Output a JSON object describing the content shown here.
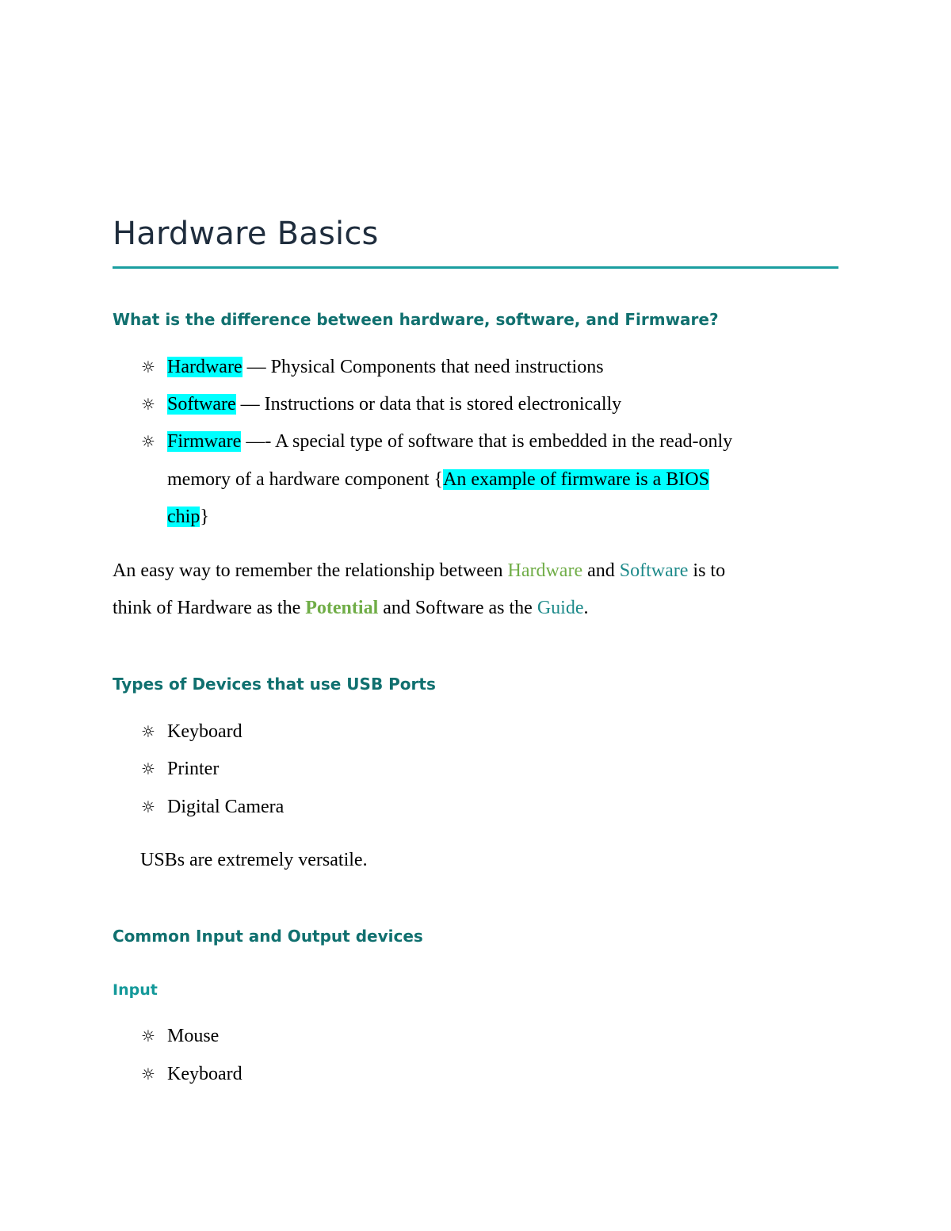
{
  "document": {
    "title": "Hardware Basics",
    "section1": {
      "heading": "What is the difference between hardware, software, and Firmware?",
      "items": [
        {
          "term": "Hardware",
          "rest": " — Physical Components that need instructions"
        },
        {
          "term": "Software",
          "rest": " — Instructions or data that is stored electronically"
        },
        {
          "term": "Firmware",
          "rest_line1": " —- A special type of software that is embedded in the read-only",
          "rest_line2_pre": "memory of a hardware component {",
          "highlight_line2": "An example of firmware is a BIOS ",
          "highlight_line3": "chip",
          "rest_line3": "}"
        }
      ],
      "paragraph": {
        "p1": "An easy way to remember the relationship between ",
        "hardware": "Hardware",
        "p2": " and ",
        "software": "Software",
        "p3": " is to",
        "p4": "think of Hardware as the ",
        "potential": "Potential",
        "p5": " and Software as the ",
        "guide": "Guide",
        "p6": "."
      }
    },
    "section2": {
      "heading": "Types of Devices that use USB Ports",
      "items": [
        "Keyboard",
        "Printer",
        "Digital Camera"
      ],
      "note": "USBs are extremely versatile."
    },
    "section3": {
      "heading": "Common Input and Output devices",
      "subheading": "Input",
      "items": [
        "Mouse",
        "Keyboard"
      ]
    },
    "bullet_icon": "☼",
    "colors": {
      "heading": "#10706f",
      "subheading": "#14999a",
      "rule": "#1a9ea0",
      "highlight": "#00ffff",
      "green": "#70ad47",
      "teal": "#1d8a8a"
    }
  }
}
